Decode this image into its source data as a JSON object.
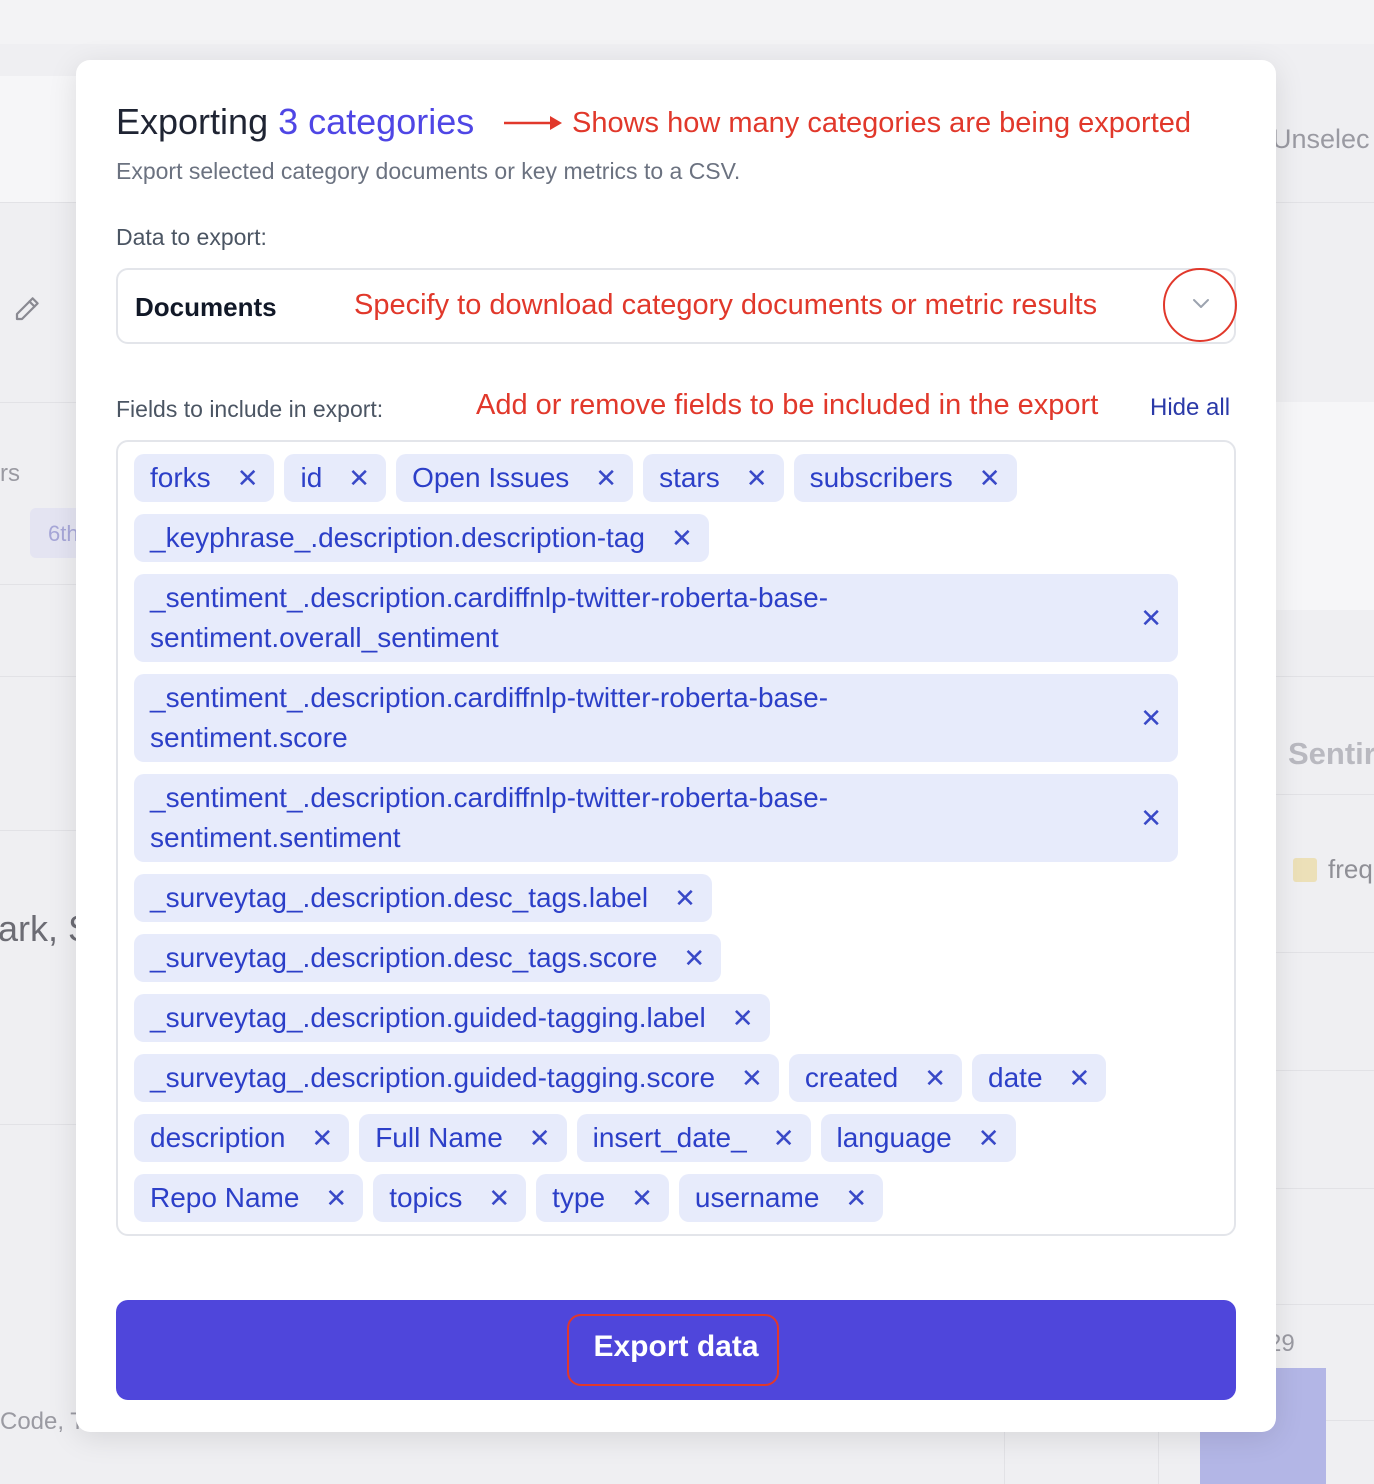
{
  "background": {
    "partial_texts": {
      "unselect": "Unselec",
      "rs": "rs",
      "chip_6th": "6th",
      "ark": "ark, S",
      "sentiment": "Sentir",
      "freq": "freq",
      "num_29": "29",
      "code": "Code, T"
    }
  },
  "modal": {
    "title_prefix": "Exporting",
    "title_count": "3 categories",
    "subtitle": "Export selected category documents or key metrics to a CSV.",
    "data_label": "Data to export:",
    "data_value": "Documents",
    "fields_label": "Fields to include in export:",
    "hide_all": "Hide all",
    "export_button": "Export data",
    "tag_remove_glyph": "✕",
    "fields": [
      "forks",
      "id",
      "Open Issues",
      "stars",
      "subscribers",
      "_keyphrase_.description.description-tag",
      "_sentiment_.description.cardiffnlp-twitter-roberta-base-sentiment.overall_sentiment",
      "_sentiment_.description.cardiffnlp-twitter-roberta-base-sentiment.score",
      "_sentiment_.description.cardiffnlp-twitter-roberta-base-sentiment.sentiment",
      "_surveytag_.description.desc_tags.label",
      "_surveytag_.description.desc_tags.score",
      "_surveytag_.description.guided-tagging.label",
      "_surveytag_.description.guided-tagging.score",
      "created",
      "date",
      "description",
      "Full Name",
      "insert_date_",
      "language",
      "Repo Name",
      "topics",
      "type",
      "username"
    ]
  },
  "annotations": {
    "title_note": "Shows how many categories are being exported",
    "select_note": "Specify to download category documents or metric results",
    "fields_note": "Add or remove fields to be included in the export"
  },
  "colors": {
    "accent": "#4f46e5",
    "annotation": "#e1382b",
    "tag_bg": "#e7ebfb",
    "tag_text": "#2c3fc8",
    "button": "#4f46db"
  }
}
